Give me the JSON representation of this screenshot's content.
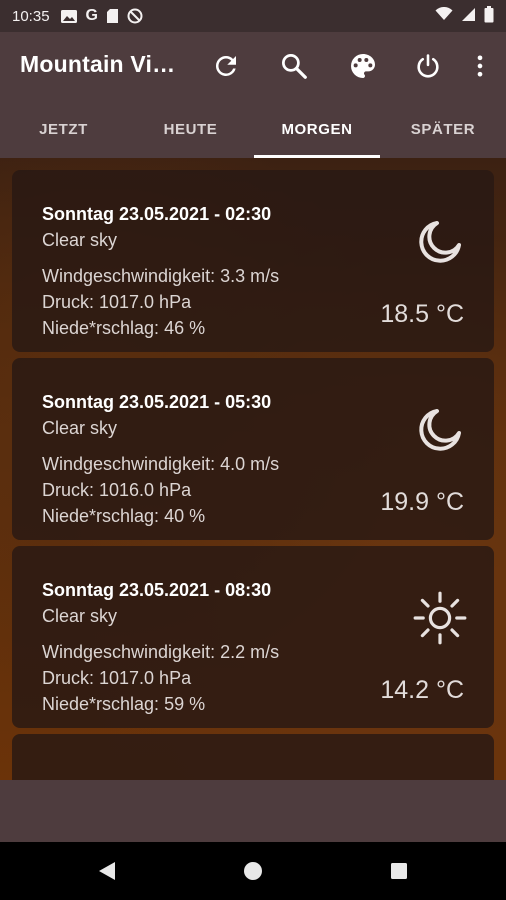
{
  "status_bar": {
    "time": "10:35",
    "left_icons": [
      "image-icon",
      "google-g-icon",
      "sd-card-icon",
      "do-not-disturb-icon"
    ],
    "right_icons": [
      "wifi-icon",
      "signal-icon",
      "battery-icon"
    ],
    "g_letter": "G"
  },
  "app_bar": {
    "title": "Mountain Vi…",
    "actions": [
      "refresh-icon",
      "search-icon",
      "palette-icon",
      "power-icon",
      "more-vert-icon"
    ]
  },
  "tabs": [
    {
      "label": "JETZT"
    },
    {
      "label": "HEUTE"
    },
    {
      "label": "MORGEN"
    },
    {
      "label": "SPÄTER"
    }
  ],
  "active_tab": "MORGEN",
  "forecasts": [
    {
      "datetime": "Sonntag 23.05.2021 - 02:30",
      "condition": "Clear sky",
      "wind": "Windgeschwindigkeit: 3.3 m/s",
      "pressure": "Druck: 1017.0 hPa",
      "precipitation": "Niede*rschlag: 46 %",
      "temperature": "18.5 °C",
      "icon": "moon-icon"
    },
    {
      "datetime": "Sonntag 23.05.2021 - 05:30",
      "condition": "Clear sky",
      "wind": "Windgeschwindigkeit: 4.0 m/s",
      "pressure": "Druck: 1016.0 hPa",
      "precipitation": "Niede*rschlag: 40 %",
      "temperature": "19.9 °C",
      "icon": "moon-icon"
    },
    {
      "datetime": "Sonntag 23.05.2021 - 08:30",
      "condition": "Clear sky",
      "wind": "Windgeschwindigkeit: 2.2 m/s",
      "pressure": "Druck: 1017.0 hPa",
      "precipitation": "Niede*rschlag: 59 %",
      "temperature": "14.2 °C",
      "icon": "sun-icon"
    }
  ],
  "nav_bar": [
    "back-icon",
    "home-icon",
    "recents-icon"
  ],
  "colors": {
    "status_bar": "#3b2e2f",
    "app_bar": "#4e3c3e",
    "card": "#281814",
    "background_brown": "#6b3309"
  }
}
